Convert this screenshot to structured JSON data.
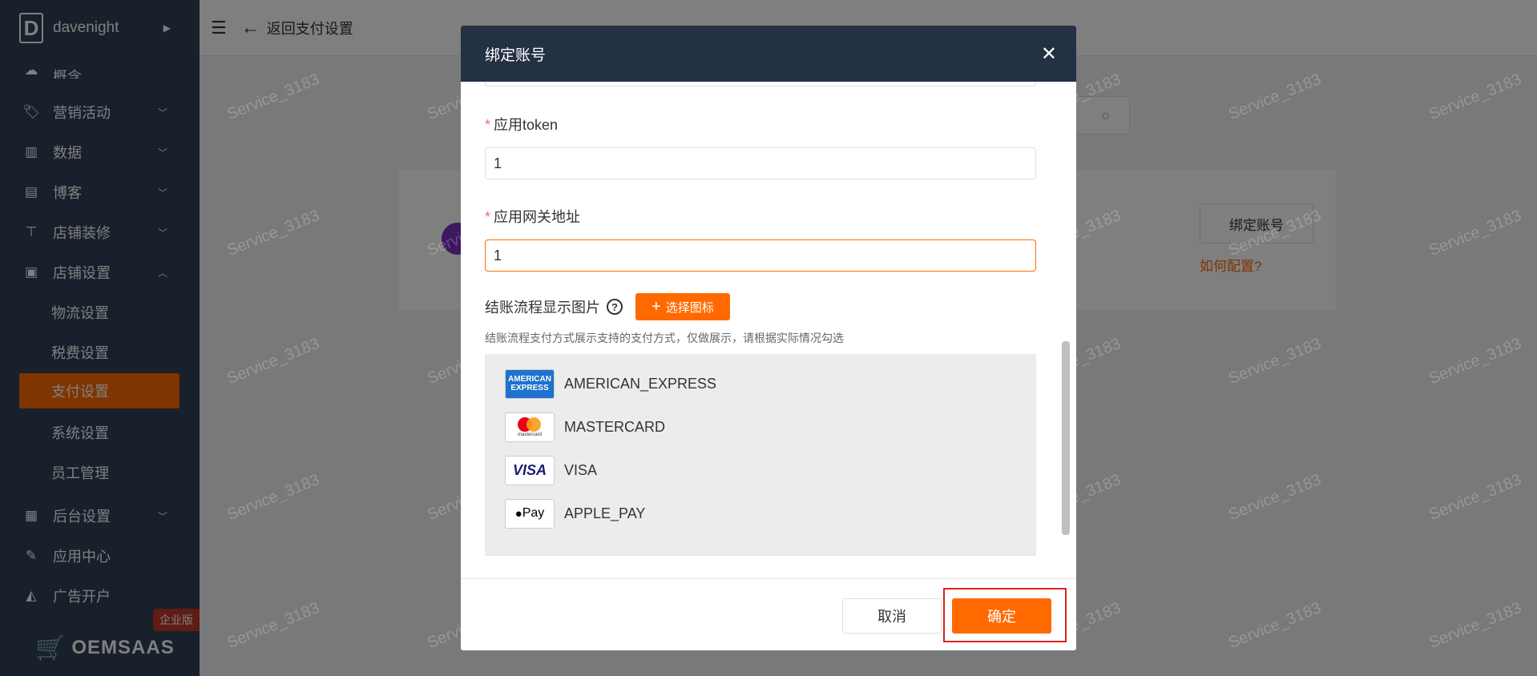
{
  "sidebar": {
    "brand_letter": "D",
    "brand_name": "davenight",
    "partial_item": "概含",
    "items": [
      {
        "label": "营销活动",
        "icon": "tag-icon"
      },
      {
        "label": "数据",
        "icon": "bar-chart-icon"
      },
      {
        "label": "博客",
        "icon": "document-icon"
      },
      {
        "label": "店铺装修",
        "icon": "paint-roller-icon"
      },
      {
        "label": "店铺设置",
        "icon": "store-icon"
      }
    ],
    "sub_items": [
      "物流设置",
      "税费设置",
      "支付设置",
      "系统设置",
      "员工管理"
    ],
    "active_sub": "支付设置",
    "lower_items": [
      {
        "label": "后台设置",
        "icon": "monitor-icon"
      },
      {
        "label": "应用中心",
        "icon": "wrench-icon"
      },
      {
        "label": "广告开户",
        "icon": "ad-icon"
      }
    ],
    "footer_text": "OEMSAAS",
    "footer_badge": "企业版"
  },
  "header": {
    "back_text": "返回支付设置"
  },
  "background": {
    "bind_button": "绑定账号",
    "config_link": "如何配置?"
  },
  "watermark": "Service_3183",
  "dialog": {
    "title": "绑定账号",
    "fields": [
      {
        "label": "应用token",
        "value": "1",
        "required": true
      },
      {
        "label": "应用网关地址",
        "value": "1",
        "required": true
      }
    ],
    "image_label": "结账流程显示图片",
    "select_icon_button": "选择图标",
    "hint": "结账流程支付方式展示支持的支付方式，仅做展示，请根据实际情况勾选",
    "cards": [
      {
        "name": "AMERICAN_EXPRESS",
        "logo": "amex-logo"
      },
      {
        "name": "MASTERCARD",
        "logo": "mastercard-logo"
      },
      {
        "name": "VISA",
        "logo": "visa-logo"
      },
      {
        "name": "APPLE_PAY",
        "logo": "applepay-logo"
      }
    ],
    "logo_text": {
      "amex_line1": "AMERICAN",
      "amex_line2": "EXPRESS",
      "mastercard": "mastercard",
      "visa": "VISA",
      "applepay": "Pay"
    },
    "cancel_button": "取消",
    "confirm_button": "确定"
  },
  "colors": {
    "accent": "#ff6a00",
    "sidebar_bg": "#304156",
    "dialog_header_bg": "#243044",
    "highlight_border": "#e02020"
  }
}
